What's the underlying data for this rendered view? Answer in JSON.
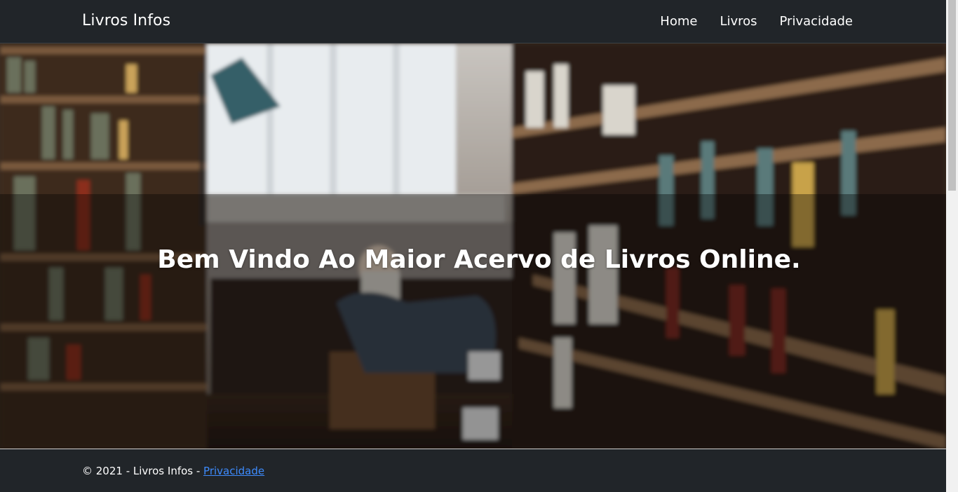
{
  "navbar": {
    "brand": "Livros Infos",
    "links": [
      "Home",
      "Livros",
      "Privacidade"
    ]
  },
  "hero": {
    "title": "Bem Vindo Ao Maior Acervo de Livros Online."
  },
  "footer": {
    "copyright": "© 2021 - Livros Infos - ",
    "privacy_link": "Privacidade"
  },
  "colors": {
    "navbar_bg": "#212529",
    "link_blue": "#3d8bfd",
    "text_white": "#ffffff"
  }
}
